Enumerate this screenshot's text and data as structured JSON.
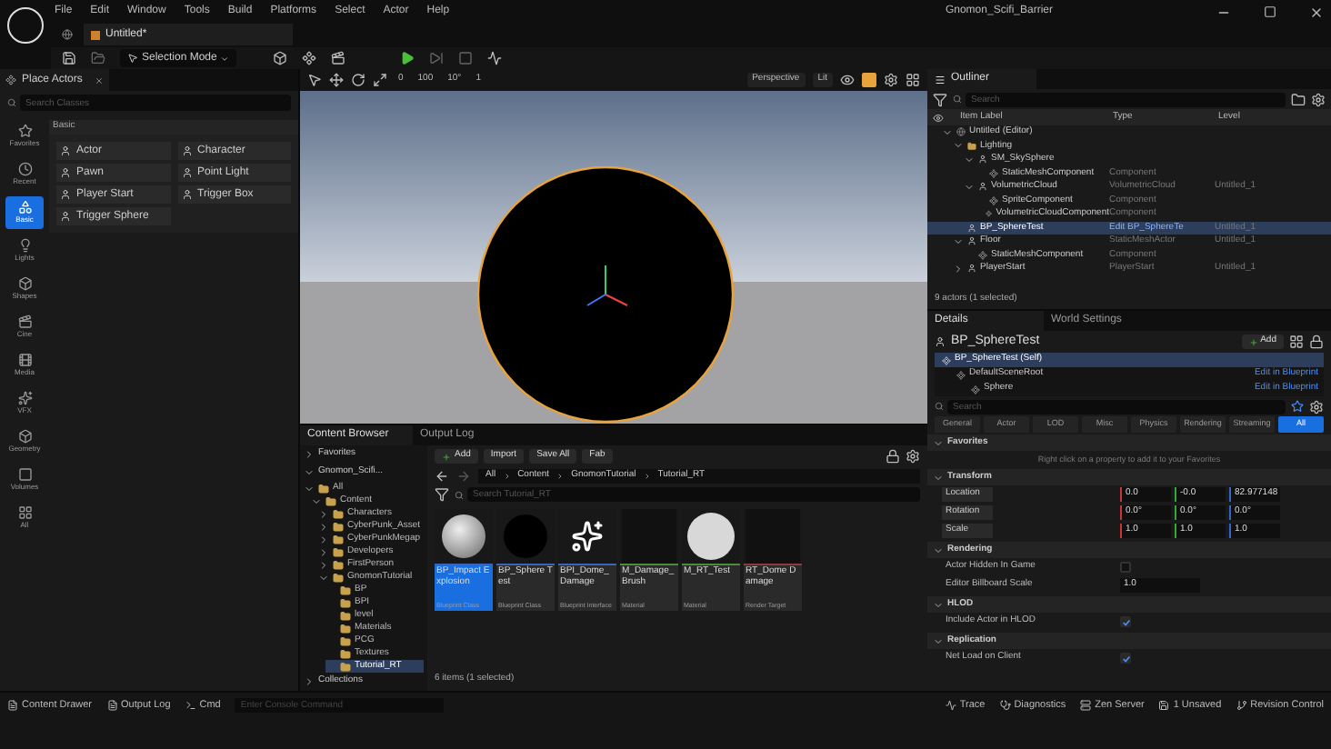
{
  "menu": [
    "File",
    "Edit",
    "Window",
    "Tools",
    "Build",
    "Platforms",
    "Select",
    "Actor",
    "Help"
  ],
  "project_title": "Gnomon_Scifi_Barrier",
  "document_tab": "Untitled*",
  "toolbar": {
    "mode": "Selection Mode"
  },
  "place_actors": {
    "title": "Place Actors",
    "search_placeholder": "Search Classes",
    "section": "Basic",
    "categories": [
      {
        "label": "Favorites",
        "kind": "star",
        "selected": false
      },
      {
        "label": "Recent",
        "kind": "clock",
        "selected": false
      },
      {
        "label": "Basic",
        "kind": "basic",
        "selected": true
      },
      {
        "label": "Lights",
        "kind": "light",
        "selected": false
      },
      {
        "label": "Shapes",
        "kind": "shapes",
        "selected": false
      },
      {
        "label": "Cine",
        "kind": "cine",
        "selected": false
      },
      {
        "label": "Media",
        "kind": "media",
        "selected": false
      },
      {
        "label": "VFX",
        "kind": "vfx",
        "selected": false
      },
      {
        "label": "Geometry",
        "kind": "geometry",
        "selected": false
      },
      {
        "label": "Volumes",
        "kind": "volume",
        "selected": false
      },
      {
        "label": "All",
        "kind": "all",
        "selected": false
      }
    ],
    "actors": [
      "Actor",
      "Character",
      "Pawn",
      "Point Light",
      "Player Start",
      "Trigger Box",
      "Trigger Sphere"
    ]
  },
  "viewport": {
    "snap_values": [
      "0",
      "100",
      "10°",
      "1"
    ],
    "view_mode": "Perspective",
    "lighting": "Lit"
  },
  "content_browser": {
    "tabs": [
      {
        "label": "Content Browser",
        "selected": true
      },
      {
        "label": "Output Log",
        "selected": false
      }
    ],
    "favorites": "Favorites",
    "project": "Gnomon_Scifi...",
    "collections": "Collections",
    "tree": [
      {
        "label": "All",
        "expanded": true,
        "selected": false,
        "children": [
          {
            "label": "Content",
            "expanded": true,
            "selected": false,
            "children": [
              {
                "label": "Characters",
                "expanded": false,
                "selected": false
              },
              {
                "label": "CyberPunk_Asset",
                "expanded": false,
                "selected": false
              },
              {
                "label": "CyberPunkMegap",
                "expanded": false,
                "selected": false
              },
              {
                "label": "Developers",
                "expanded": false,
                "selected": false
              },
              {
                "label": "FirstPerson",
                "expanded": false,
                "selected": false
              },
              {
                "label": "GnomonTutorial",
                "expanded": true,
                "selected": false,
                "children": [
                  {
                    "label": "BP",
                    "selected": false
                  },
                  {
                    "label": "BPI",
                    "selected": false
                  },
                  {
                    "label": "level",
                    "selected": false
                  },
                  {
                    "label": "Materials",
                    "selected": false
                  },
                  {
                    "label": "PCG",
                    "selected": false
                  },
                  {
                    "label": "Textures",
                    "selected": false
                  },
                  {
                    "label": "Tutorial_RT",
                    "selected": true
                  }
                ]
              }
            ]
          }
        ]
      }
    ],
    "buttons": [
      "Add",
      "Import",
      "Save All",
      "Fab"
    ],
    "breadcrumb": [
      "All",
      "Content",
      "GnomonTutorial",
      "Tutorial_RT"
    ],
    "search_placeholder": "Search Tutorial_RT",
    "assets": [
      {
        "name": "BP_Impact Explosion",
        "type": "Blueprint Class",
        "kind": "glossy-sphere",
        "color": "#3b63b8",
        "selected": true
      },
      {
        "name": "BP_Sphere Test",
        "type": "Blueprint Class",
        "kind": "dark-sphere",
        "color": "#3b63b8",
        "selected": false
      },
      {
        "name": "BPI_Dome_ Damage",
        "type": "Blueprint Interface",
        "kind": "pickup-icon",
        "color": "#3b63b8",
        "selected": false
      },
      {
        "name": "M_Damage_ Brush",
        "type": "Material",
        "kind": "dark",
        "color": "#4e8a3c",
        "selected": false
      },
      {
        "name": "M_RT_Test",
        "type": "Material",
        "kind": "white-sphere",
        "color": "#4e8a3c",
        "selected": false
      },
      {
        "name": "RT_Dome Damage",
        "type": "Render Target",
        "kind": "dark",
        "color": "#8a3c3c",
        "selected": false
      }
    ],
    "footer": "6 items (1 selected)"
  },
  "outliner": {
    "title": "Outliner",
    "search_placeholder": "Search",
    "columns": [
      "Item Label",
      "Type",
      "Level"
    ],
    "rows": [
      {
        "label": "Untitled (Editor)",
        "kind": "world",
        "expanded": true,
        "selected": false,
        "children": [
          {
            "label": "Lighting",
            "kind": "folder",
            "expanded": true,
            "selected": false,
            "children": [
              {
                "label": "SM_SkySphere",
                "kind": "actor",
                "expanded": true,
                "selected": false,
                "children": [
                  {
                    "label": "StaticMeshComponent",
                    "kind": "component",
                    "type": "Component",
                    "selected": false
                  }
                ]
              },
              {
                "label": "VolumetricCloud",
                "kind": "actor",
                "type": "VolumetricCloud",
                "level": "Untitled_1",
                "expanded": true,
                "selected": false,
                "children": [
                  {
                    "label": "SpriteComponent",
                    "kind": "component",
                    "type": "Component",
                    "selected": false
                  },
                  {
                    "label": "VolumetricCloudComponent",
                    "kind": "component",
                    "type": "Component",
                    "selected": false
                  }
                ]
              }
            ]
          },
          {
            "label": "BP_SphereTest",
            "kind": "actor",
            "type": "Edit BP_SphereTe",
            "level": "Untitled_1",
            "selected": true
          },
          {
            "label": "Floor",
            "kind": "actor",
            "type": "StaticMeshActor",
            "level": "Untitled_1",
            "expanded": true,
            "selected": false,
            "children": [
              {
                "label": "StaticMeshComponent",
                "kind": "component",
                "type": "Component",
                "selected": false
              }
            ]
          },
          {
            "label": "PlayerStart",
            "kind": "actor",
            "type": "PlayerStart",
            "level": "Untitled_1",
            "expanded": false,
            "selected": false
          }
        ]
      }
    ],
    "footer": "9 actors (1 selected)"
  },
  "details": {
    "tabs": [
      {
        "label": "Details",
        "selected": true
      },
      {
        "label": "World Settings",
        "selected": false
      }
    ],
    "actor": "BP_SphereTest",
    "add_button": "Add",
    "components": [
      {
        "label": "BP_SphereTest (Self)",
        "selected": true,
        "children": [
          {
            "label": "DefaultSceneRoot",
            "link": "Edit in Blueprint",
            "selected": false,
            "children": [
              {
                "label": "Sphere",
                "link": "Edit in Blueprint",
                "selected": false
              }
            ]
          }
        ]
      }
    ],
    "search_placeholder": "Search",
    "filters": [
      {
        "label": "General",
        "selected": false
      },
      {
        "label": "Actor",
        "selected": false
      },
      {
        "label": "LOD",
        "selected": false
      },
      {
        "label": "Misc",
        "selected": false
      },
      {
        "label": "Physics",
        "selected": false
      },
      {
        "label": "Rendering",
        "selected": false
      },
      {
        "label": "Streaming",
        "selected": false
      },
      {
        "label": "All",
        "selected": true
      }
    ],
    "sections": [
      {
        "title": "Favorites",
        "rows": [
          {
            "kind": "hint",
            "text": "Right click on a property to add it to your Favorites"
          }
        ]
      },
      {
        "title": "Transform",
        "rows": [
          {
            "kind": "vector",
            "label": "Location",
            "values": [
              "0.0",
              "-0.0",
              "82.977148"
            ]
          },
          {
            "kind": "vector",
            "label": "Rotation",
            "values": [
              "0.0°",
              "0.0°",
              "0.0°"
            ]
          },
          {
            "kind": "vector",
            "label": "Scale",
            "values": [
              "1.0",
              "1.0",
              "1.0"
            ]
          }
        ]
      },
      {
        "title": "Rendering",
        "rows": [
          {
            "kind": "checkbox",
            "label": "Actor Hidden In Game",
            "checked": false
          },
          {
            "kind": "number",
            "label": "Editor Billboard Scale",
            "value": "1.0"
          }
        ]
      },
      {
        "title": "HLOD",
        "rows": [
          {
            "kind": "checkbox",
            "label": "Include Actor in HLOD",
            "checked": true
          }
        ]
      },
      {
        "title": "Replication",
        "rows": [
          {
            "kind": "checkbox",
            "label": "Net Load on Client",
            "checked": true
          }
        ]
      }
    ]
  },
  "status_bar": {
    "items": [
      "Content Drawer",
      "Output Log",
      "Cmd"
    ],
    "console_placeholder": "Enter Console Command",
    "right_items": [
      "Trace",
      "Diagnostics",
      "Zen Server",
      "1 Unsaved",
      "Revision Control"
    ]
  }
}
